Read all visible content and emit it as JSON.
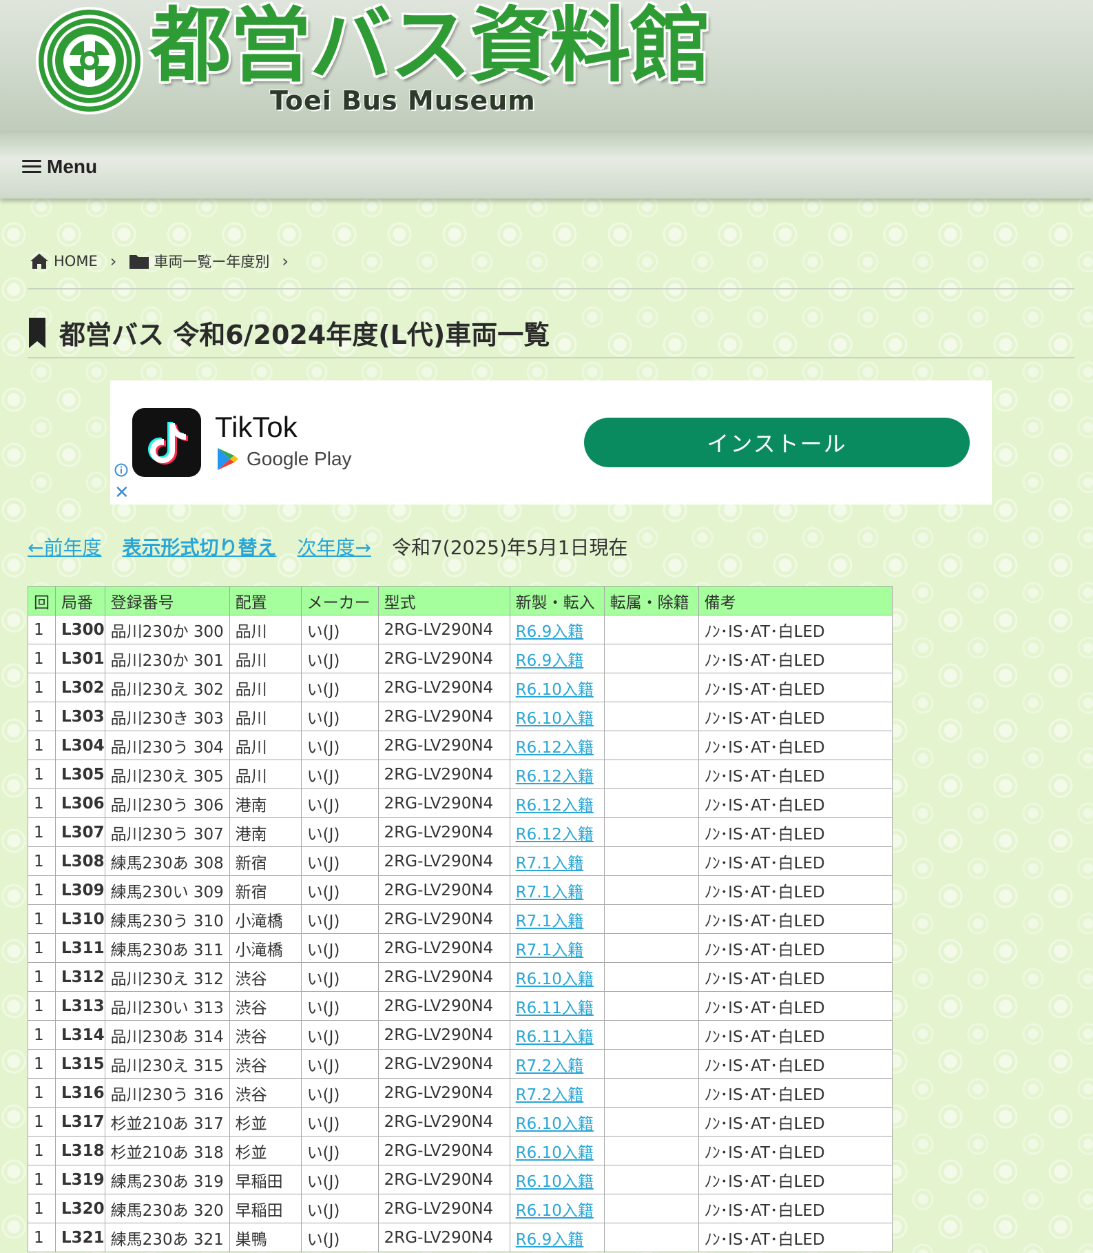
{
  "site": {
    "title": "都営バス資料館",
    "subtitle": "Toei Bus Museum"
  },
  "menu": {
    "label": "Menu"
  },
  "breadcrumb": {
    "home": "HOME",
    "category": "車両一覧ー年度別"
  },
  "page_title": "都営バス 令和6/2024年度(L代)車両一覧",
  "ad": {
    "app_name": "TikTok",
    "store": "Google Play",
    "install_label": "インストール",
    "colors": {
      "install": "#0a8a5f"
    }
  },
  "nav": {
    "prev": "←前年度",
    "toggle": "表示形式切り替え",
    "next": "次年度→",
    "as_of": "令和7(2025)年5月1日現在"
  },
  "table": {
    "headers": [
      "回",
      "局番",
      "登録番号",
      "配置",
      "メーカー",
      "型式",
      "新製・転入",
      "転属・除籍",
      "備考"
    ],
    "rows": [
      {
        "kai": "1",
        "no": "L300",
        "reg": "品川230か 300",
        "depot": "品川",
        "maker": "い(J)",
        "model": "2RG-LV290N4",
        "new": "R6.9入籍",
        "trans": "",
        "note": "ﾉﾝ･IS･AT･白LED"
      },
      {
        "kai": "1",
        "no": "L301",
        "reg": "品川230か 301",
        "depot": "品川",
        "maker": "い(J)",
        "model": "2RG-LV290N4",
        "new": "R6.9入籍",
        "trans": "",
        "note": "ﾉﾝ･IS･AT･白LED"
      },
      {
        "kai": "1",
        "no": "L302",
        "reg": "品川230え 302",
        "depot": "品川",
        "maker": "い(J)",
        "model": "2RG-LV290N4",
        "new": "R6.10入籍",
        "trans": "",
        "note": "ﾉﾝ･IS･AT･白LED"
      },
      {
        "kai": "1",
        "no": "L303",
        "reg": "品川230き 303",
        "depot": "品川",
        "maker": "い(J)",
        "model": "2RG-LV290N4",
        "new": "R6.10入籍",
        "trans": "",
        "note": "ﾉﾝ･IS･AT･白LED"
      },
      {
        "kai": "1",
        "no": "L304",
        "reg": "品川230う 304",
        "depot": "品川",
        "maker": "い(J)",
        "model": "2RG-LV290N4",
        "new": "R6.12入籍",
        "trans": "",
        "note": "ﾉﾝ･IS･AT･白LED"
      },
      {
        "kai": "1",
        "no": "L305",
        "reg": "品川230え 305",
        "depot": "品川",
        "maker": "い(J)",
        "model": "2RG-LV290N4",
        "new": "R6.12入籍",
        "trans": "",
        "note": "ﾉﾝ･IS･AT･白LED"
      },
      {
        "kai": "1",
        "no": "L306",
        "reg": "品川230う 306",
        "depot": "港南",
        "maker": "い(J)",
        "model": "2RG-LV290N4",
        "new": "R6.12入籍",
        "trans": "",
        "note": "ﾉﾝ･IS･AT･白LED"
      },
      {
        "kai": "1",
        "no": "L307",
        "reg": "品川230う 307",
        "depot": "港南",
        "maker": "い(J)",
        "model": "2RG-LV290N4",
        "new": "R6.12入籍",
        "trans": "",
        "note": "ﾉﾝ･IS･AT･白LED"
      },
      {
        "kai": "1",
        "no": "L308",
        "reg": "練馬230あ 308",
        "depot": "新宿",
        "maker": "い(J)",
        "model": "2RG-LV290N4",
        "new": "R7.1入籍",
        "trans": "",
        "note": "ﾉﾝ･IS･AT･白LED"
      },
      {
        "kai": "1",
        "no": "L309",
        "reg": "練馬230い 309",
        "depot": "新宿",
        "maker": "い(J)",
        "model": "2RG-LV290N4",
        "new": "R7.1入籍",
        "trans": "",
        "note": "ﾉﾝ･IS･AT･白LED"
      },
      {
        "kai": "1",
        "no": "L310",
        "reg": "練馬230う 310",
        "depot": "小滝橋",
        "maker": "い(J)",
        "model": "2RG-LV290N4",
        "new": "R7.1入籍",
        "trans": "",
        "note": "ﾉﾝ･IS･AT･白LED"
      },
      {
        "kai": "1",
        "no": "L311",
        "reg": "練馬230あ 311",
        "depot": "小滝橋",
        "maker": "い(J)",
        "model": "2RG-LV290N4",
        "new": "R7.1入籍",
        "trans": "",
        "note": "ﾉﾝ･IS･AT･白LED"
      },
      {
        "kai": "1",
        "no": "L312",
        "reg": "品川230え 312",
        "depot": "渋谷",
        "maker": "い(J)",
        "model": "2RG-LV290N4",
        "new": "R6.10入籍",
        "trans": "",
        "note": "ﾉﾝ･IS･AT･白LED"
      },
      {
        "kai": "1",
        "no": "L313",
        "reg": "品川230い 313",
        "depot": "渋谷",
        "maker": "い(J)",
        "model": "2RG-LV290N4",
        "new": "R6.11入籍",
        "trans": "",
        "note": "ﾉﾝ･IS･AT･白LED"
      },
      {
        "kai": "1",
        "no": "L314",
        "reg": "品川230あ 314",
        "depot": "渋谷",
        "maker": "い(J)",
        "model": "2RG-LV290N4",
        "new": "R6.11入籍",
        "trans": "",
        "note": "ﾉﾝ･IS･AT･白LED"
      },
      {
        "kai": "1",
        "no": "L315",
        "reg": "品川230え 315",
        "depot": "渋谷",
        "maker": "い(J)",
        "model": "2RG-LV290N4",
        "new": "R7.2入籍",
        "trans": "",
        "note": "ﾉﾝ･IS･AT･白LED"
      },
      {
        "kai": "1",
        "no": "L316",
        "reg": "品川230う 316",
        "depot": "渋谷",
        "maker": "い(J)",
        "model": "2RG-LV290N4",
        "new": "R7.2入籍",
        "trans": "",
        "note": "ﾉﾝ･IS･AT･白LED"
      },
      {
        "kai": "1",
        "no": "L317",
        "reg": "杉並210あ 317",
        "depot": "杉並",
        "maker": "い(J)",
        "model": "2RG-LV290N4",
        "new": "R6.10入籍",
        "trans": "",
        "note": "ﾉﾝ･IS･AT･白LED"
      },
      {
        "kai": "1",
        "no": "L318",
        "reg": "杉並210あ 318",
        "depot": "杉並",
        "maker": "い(J)",
        "model": "2RG-LV290N4",
        "new": "R6.10入籍",
        "trans": "",
        "note": "ﾉﾝ･IS･AT･白LED"
      },
      {
        "kai": "1",
        "no": "L319",
        "reg": "練馬230あ 319",
        "depot": "早稲田",
        "maker": "い(J)",
        "model": "2RG-LV290N4",
        "new": "R6.10入籍",
        "trans": "",
        "note": "ﾉﾝ･IS･AT･白LED"
      },
      {
        "kai": "1",
        "no": "L320",
        "reg": "練馬230あ 320",
        "depot": "早稲田",
        "maker": "い(J)",
        "model": "2RG-LV290N4",
        "new": "R6.10入籍",
        "trans": "",
        "note": "ﾉﾝ･IS･AT･白LED"
      },
      {
        "kai": "1",
        "no": "L321",
        "reg": "練馬230あ 321",
        "depot": "巣鴨",
        "maker": "い(J)",
        "model": "2RG-LV290N4",
        "new": "R6.9入籍",
        "trans": "",
        "note": "ﾉﾝ･IS･AT･白LED"
      }
    ]
  },
  "colors": {
    "logo_green": "#2f9b35",
    "link": "#2aa6d6",
    "table_header": "#a5ff9c",
    "background": "#e4f4cf"
  },
  "icons": [
    "logo-emblem-icon",
    "hamburger-icon",
    "home-icon",
    "chevron-right-icon",
    "folder-icon",
    "bookmark-icon",
    "tiktok-icon",
    "google-play-icon",
    "info-icon",
    "close-icon"
  ]
}
